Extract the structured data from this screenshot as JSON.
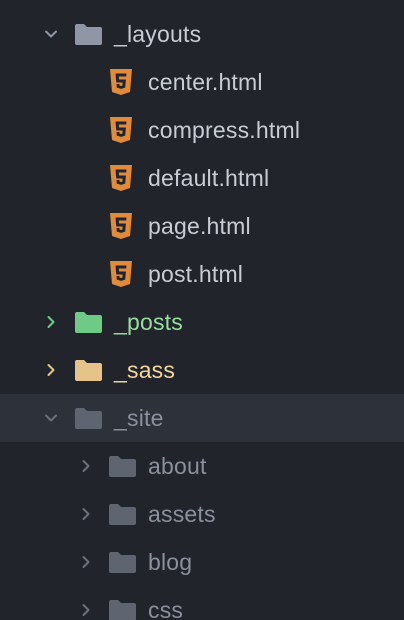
{
  "colors": {
    "background": "#21252b",
    "selected_row": "#2c313a",
    "folder_default": "#8f97a6",
    "folder_green": "#6fca86",
    "folder_yellow": "#e5c38b",
    "folder_dim": "#5f6570",
    "html_icon": "#e08a3c"
  },
  "tree": {
    "layouts": {
      "name": "_layouts",
      "icon": "folder-open-icon",
      "expanded": true,
      "files": [
        {
          "name": "center.html",
          "icon": "html5-icon"
        },
        {
          "name": "compress.html",
          "icon": "html5-icon"
        },
        {
          "name": "default.html",
          "icon": "html5-icon"
        },
        {
          "name": "page.html",
          "icon": "html5-icon"
        },
        {
          "name": "post.html",
          "icon": "html5-icon"
        }
      ]
    },
    "posts": {
      "name": "_posts",
      "icon": "folder-icon",
      "expanded": false
    },
    "sass": {
      "name": "_sass",
      "icon": "folder-icon",
      "expanded": false
    },
    "site": {
      "name": "_site",
      "icon": "folder-open-icon",
      "expanded": true,
      "selected": true,
      "children": [
        {
          "name": "about",
          "icon": "folder-icon",
          "expanded": false
        },
        {
          "name": "assets",
          "icon": "folder-icon",
          "expanded": false
        },
        {
          "name": "blog",
          "icon": "folder-icon",
          "expanded": false
        },
        {
          "name": "css",
          "icon": "folder-icon",
          "expanded": false
        }
      ]
    }
  }
}
